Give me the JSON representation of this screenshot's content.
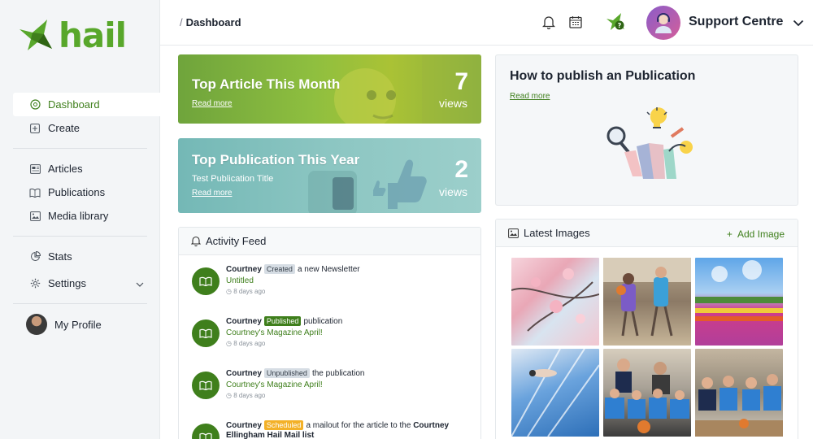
{
  "brand": {
    "name": "hail",
    "color": "#58a72b"
  },
  "sidebar": {
    "items": [
      {
        "label": "Dashboard",
        "icon": "dashboard-icon",
        "active": true
      },
      {
        "label": "Create",
        "icon": "plus-square-icon"
      },
      {
        "label": "Articles",
        "icon": "articles-icon"
      },
      {
        "label": "Publications",
        "icon": "book-icon"
      },
      {
        "label": "Media library",
        "icon": "image-icon"
      },
      {
        "label": "Stats",
        "icon": "pie-chart-icon"
      },
      {
        "label": "Settings",
        "icon": "gear-icon"
      }
    ],
    "profile_label": "My Profile"
  },
  "topbar": {
    "breadcrumb": "Dashboard",
    "account_label": "Support Centre"
  },
  "stats": {
    "top_article": {
      "title": "Top Article This Month",
      "link": "Read more",
      "count": "7",
      "unit": "views"
    },
    "top_publication": {
      "title": "Top Publication This Year",
      "subtitle": "Test Publication Title",
      "link": "Read more",
      "count": "2",
      "unit": "views"
    }
  },
  "publish_help": {
    "title": "How to publish an Publication",
    "link": "Read more"
  },
  "activity": {
    "title": "Activity Feed",
    "items": [
      {
        "user": "Courtney",
        "badge": "Created",
        "text": "a new Newsletter",
        "link": "Untitled",
        "time": "8 days ago"
      },
      {
        "user": "Courtney",
        "badge": "Published",
        "text": "publication",
        "link": "Courtney's Magazine April!",
        "time": "8 days ago"
      },
      {
        "user": "Courtney",
        "badge": "Unpublished",
        "text": "the publication",
        "link": "Courtney's Magazine April!",
        "time": "8 days ago"
      },
      {
        "user": "Courtney",
        "badge": "Scheduled",
        "text": "a mailout for the article to the",
        "extra": "Courtney",
        "extra2": "Ellingham Hail Mail list"
      }
    ]
  },
  "latest_images": {
    "title": "Latest Images",
    "add_label": "Add Image",
    "images": [
      "cherry blossoms",
      "basketball players",
      "flower field",
      "swimmer",
      "kids basketball team",
      "kids sports team"
    ]
  },
  "colors": {
    "accent": "#3f7f1c",
    "scheduled": "#f3b128"
  }
}
